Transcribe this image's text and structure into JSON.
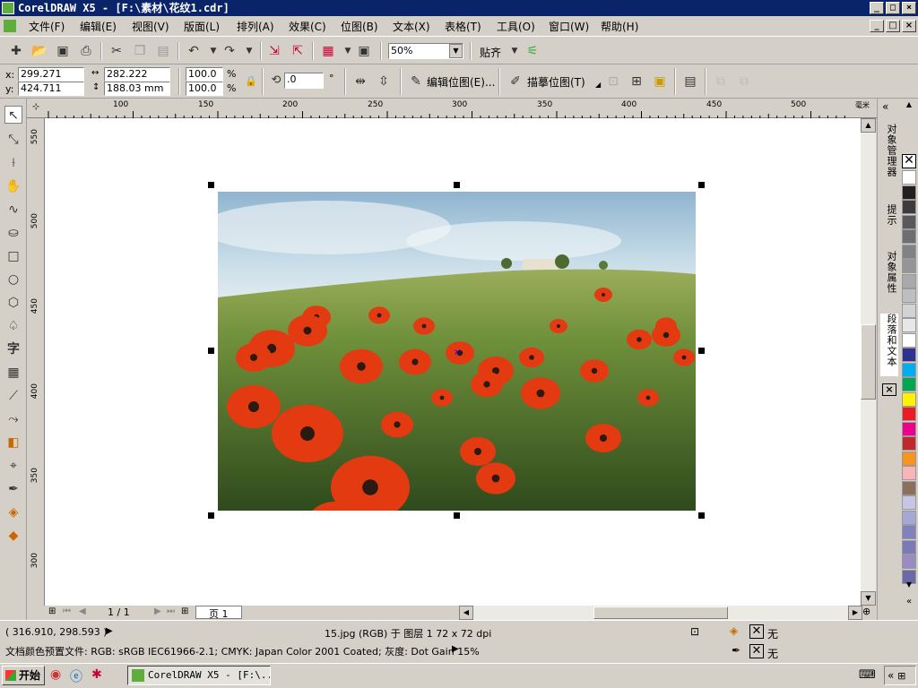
{
  "window": {
    "title": "CorelDRAW X5 - [F:\\素材\\花纹1.cdr]"
  },
  "menu": [
    "文件(F)",
    "编辑(E)",
    "视图(V)",
    "版面(L)",
    "排列(A)",
    "效果(C)",
    "位图(B)",
    "文本(X)",
    "表格(T)",
    "工具(O)",
    "窗口(W)",
    "帮助(H)"
  ],
  "toolbar": {
    "zoom": "50%",
    "snap_label": "贴齐"
  },
  "props": {
    "x_label": "x:",
    "x": "299.271 mm",
    "y_label": "y:",
    "y": "424.711 mm",
    "w": "282.222 mm",
    "h": "188.03 mm",
    "scale_w": "100.0",
    "scale_h": "100.0",
    "pct": "%",
    "angle": ".0",
    "deg": "°",
    "edit_bitmap": "编辑位图(E)...",
    "trace_bitmap": "描摹位图(T)"
  },
  "ruler": {
    "top": [
      "100",
      "150",
      "200",
      "250",
      "300",
      "350",
      "400",
      "450",
      "500"
    ],
    "unit": "毫米",
    "left": [
      "550",
      "500",
      "450",
      "400",
      "350",
      "300"
    ]
  },
  "pages": {
    "counter": "1 / 1",
    "tab": "页 1"
  },
  "status": {
    "coords": "( 316.910, 298.593 )",
    "object_info": "15.jpg (RGB) 于 图层 1 72 x 72 dpi",
    "color_profile": "文档颜色预置文件: RGB: sRGB IEC61966-2.1; CMYK: Japan Color 2001 Coated; 灰度: Dot Gain 15%",
    "fill": "无",
    "outline": "无"
  },
  "dockers": [
    "对象管理器",
    "提示",
    "对象属性",
    "段落和文本"
  ],
  "palette": [
    "#ffffff",
    "#231f20",
    "#3d3b3c",
    "#58595b",
    "#6d6e70",
    "#808285",
    "#939598",
    "#a7a9ac",
    "#bcbec0",
    "#d1d3d4",
    "#e6e7e8",
    "#ffffff",
    "#2e3192",
    "#00aeef",
    "#00a651",
    "#fff200",
    "#ed1c24",
    "#ec008c",
    "#c1272d",
    "#f7941d",
    "#f9b4b8",
    "#8c6f5c",
    "#c5c5e6",
    "#a7a7d6",
    "#8181c0",
    "#7a7ab8",
    "#9b8bc4",
    "#6a6aa8"
  ],
  "taskbar": {
    "start": "开始",
    "task": "CorelDRAW X5 - [F:\\..."
  }
}
